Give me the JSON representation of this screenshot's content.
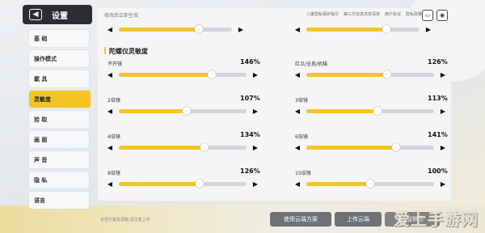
{
  "header": {
    "title": "设置",
    "back_icon": "back-icon"
  },
  "nav": {
    "items": [
      {
        "label": "基 础",
        "active": false
      },
      {
        "label": "操作模式",
        "active": false
      },
      {
        "label": "載 具",
        "active": false
      },
      {
        "label": "灵敏度",
        "active": true
      },
      {
        "label": "拾 取",
        "active": false
      },
      {
        "label": "画 面",
        "active": false
      },
      {
        "label": "声 音",
        "active": false
      },
      {
        "label": "隐 私",
        "active": false
      },
      {
        "label": "语言",
        "active": false
      }
    ]
  },
  "top": {
    "left_label": "修改后立即生效",
    "links": [
      "儿童隐私保护指引",
      "第三方信息共享清单",
      "用户协议",
      "隐私政策"
    ],
    "icons": [
      "ticket-icon",
      "profile-lock-icon"
    ]
  },
  "top_sliders": [
    {
      "fill_pct": 0.71,
      "thumb_label": "○"
    },
    {
      "fill_pct": 0.71,
      "thumb_label": "○"
    }
  ],
  "section": {
    "title": "陀螺仪灵敏度"
  },
  "gyro": [
    {
      "label": "不开镜",
      "value": "146%",
      "fill_pct": 0.73,
      "thumb_label": "○"
    },
    {
      "label": "红点/全息/机瞄",
      "value": "126%",
      "fill_pct": 0.63,
      "thumb_label": "○"
    },
    {
      "label": "2倍镜",
      "value": "107%",
      "fill_pct": 0.53,
      "thumb_label": "○"
    },
    {
      "label": "3倍镜",
      "value": "113%",
      "fill_pct": 0.56,
      "thumb_label": "○"
    },
    {
      "label": "4倍镜",
      "value": "134%",
      "fill_pct": 0.67,
      "thumb_label": "○"
    },
    {
      "label": "6倍镜",
      "value": "141%",
      "fill_pct": 0.7,
      "thumb_label": "○"
    },
    {
      "label": "8倍镜",
      "value": "126%",
      "fill_pct": 0.63,
      "thumb_label": "○"
    },
    {
      "label": "15倍镜",
      "value": "100%",
      "fill_pct": 0.5,
      "thumb_label": "○"
    }
  ],
  "arrows": {
    "left": "◀",
    "right": "▶"
  },
  "bottom": {
    "note": "本地方案有调整,请注意上传",
    "cloud_button": "使用云端方案",
    "upload_button": "上传云端",
    "reset_button": "恢复默认"
  },
  "watermark": "爱上手游网",
  "colors": {
    "accent": "#f5c524",
    "panel": "#f4f5f6",
    "header": "#2b2d31"
  }
}
